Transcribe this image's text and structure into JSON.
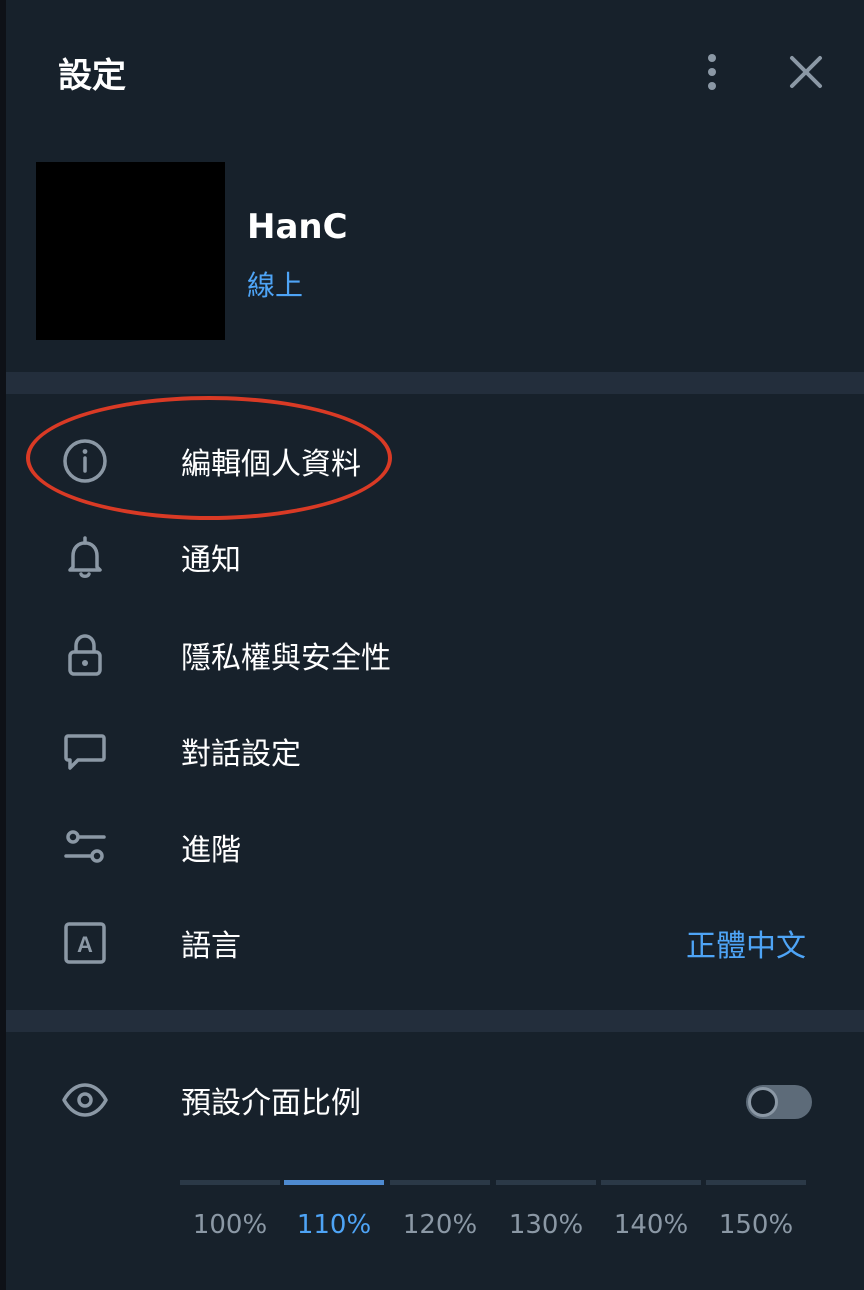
{
  "header": {
    "title": "設定"
  },
  "profile": {
    "name": "HanC",
    "status": "線上"
  },
  "menu": [
    {
      "label": "編輯個人資料",
      "icon": "info-icon"
    },
    {
      "label": "通知",
      "icon": "bell-icon"
    },
    {
      "label": "隱私權與安全性",
      "icon": "lock-icon"
    },
    {
      "label": "對話設定",
      "icon": "chat-bubble-icon"
    },
    {
      "label": "進階",
      "icon": "sliders-icon"
    },
    {
      "label": "語言",
      "icon": "language-icon",
      "value": "正體中文"
    }
  ],
  "scale": {
    "label": "預設介面比例",
    "icon": "eye-icon",
    "toggle_on": false,
    "options": [
      "100%",
      "110%",
      "120%",
      "130%",
      "140%",
      "150%"
    ],
    "selected": "110%"
  },
  "colors": {
    "background": "#17212b",
    "divider": "#232e3c",
    "accent": "#4ea4f6",
    "highlight": "#d93a25"
  }
}
